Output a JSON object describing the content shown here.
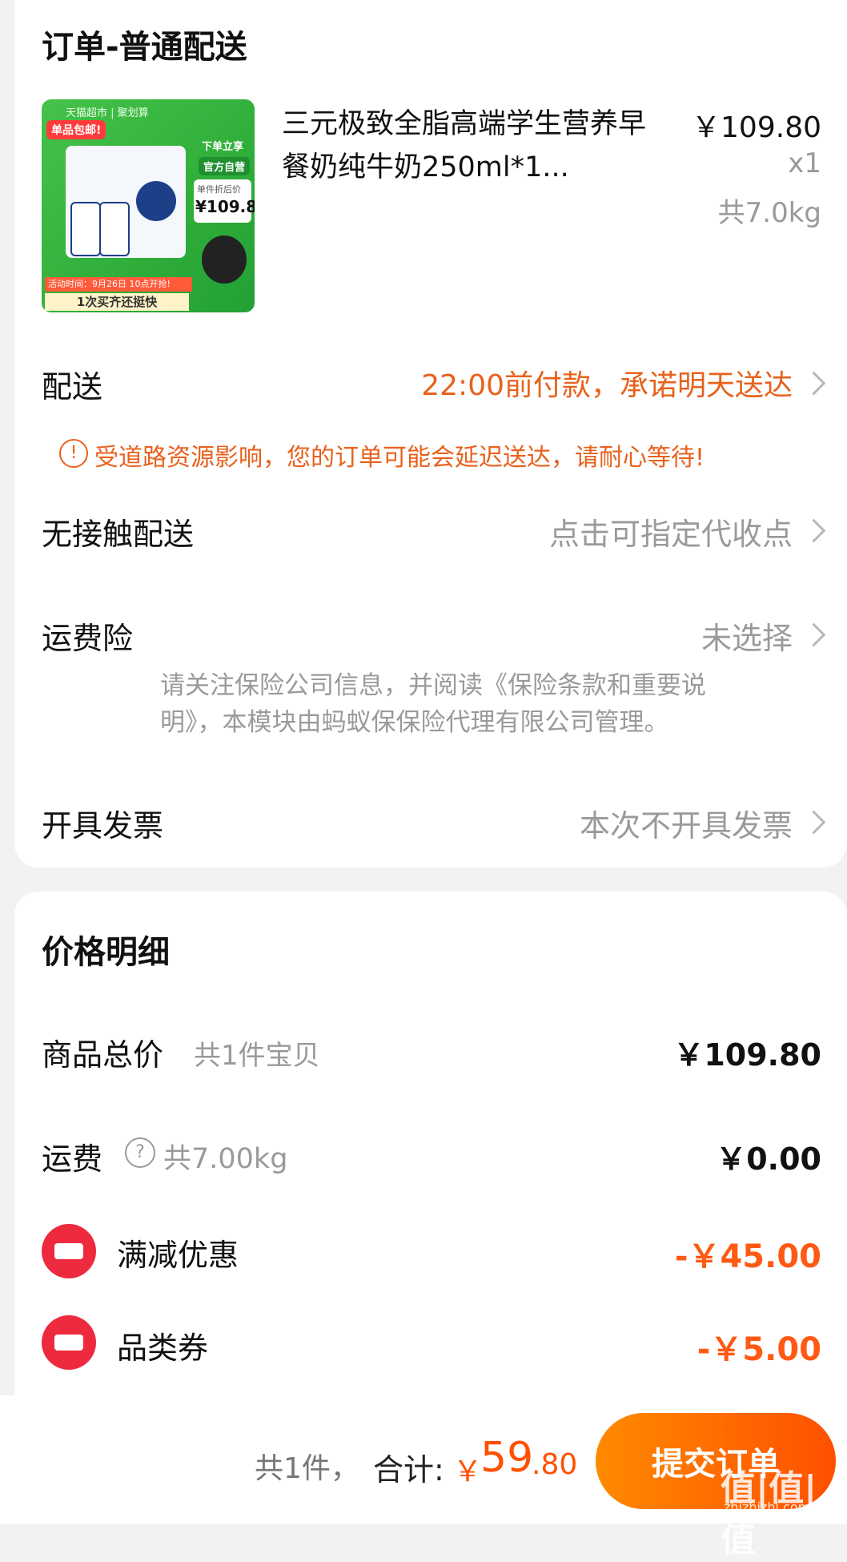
{
  "order": {
    "title": "订单-普通配送",
    "product": {
      "name": "三元极致全脂高端学生营养早餐奶纯牛奶250ml*1...",
      "price": "￥109.80",
      "qty": "x1",
      "weight": "共7.0kg",
      "thumb": {
        "store": "天猫超市 | 聚划算",
        "badge_free": "单品包邮!",
        "badge_instant": "下单立享",
        "badge_official": "官方自营",
        "unit_price_label": "单件折后价",
        "unit_price": "¥109.8",
        "activity": "活动时间：9月26日 10点开抢!",
        "buy_once": "1次买齐还挺快"
      }
    },
    "delivery": {
      "label": "配送",
      "value": "22:00前付款，承诺明天送达",
      "notice": "受道路资源影响，您的订单可能会延迟送达，请耐心等待!"
    },
    "contactless": {
      "label": "无接触配送",
      "value": "点击可指定代收点"
    },
    "insurance": {
      "label": "运费险",
      "value": "未选择",
      "desc_line1": "请关注保险公司信息，并阅读《保险条款和重要说",
      "desc_line2": "明》，本模块由蚂蚁保保险代理有限公司管理。"
    },
    "invoice": {
      "label": "开具发票",
      "value": "本次不开具发票"
    }
  },
  "price_detail": {
    "title": "价格明细",
    "goods_total_label": "商品总价",
    "goods_total_count": "共1件宝贝",
    "goods_total_value": "￥109.80",
    "shipping_label": "运费",
    "shipping_weight": "共7.00kg",
    "shipping_value": "￥0.00",
    "discount_label": "满减优惠",
    "discount_value": "-￥45.00",
    "coupon_label": "品类券",
    "coupon_value": "-￥5.00"
  },
  "footer": {
    "count": "共1件，",
    "total_label": "合计:",
    "currency": "￥",
    "total_int": "59",
    "total_dec": ".80",
    "submit": "提交订单"
  },
  "watermark": {
    "logo": "值|值|值",
    "site": "zhizhizhi.com"
  },
  "colors": {
    "accent": "#ff5000",
    "coupon": "#ee2a3e",
    "thumb_green": "#2fae3a"
  }
}
